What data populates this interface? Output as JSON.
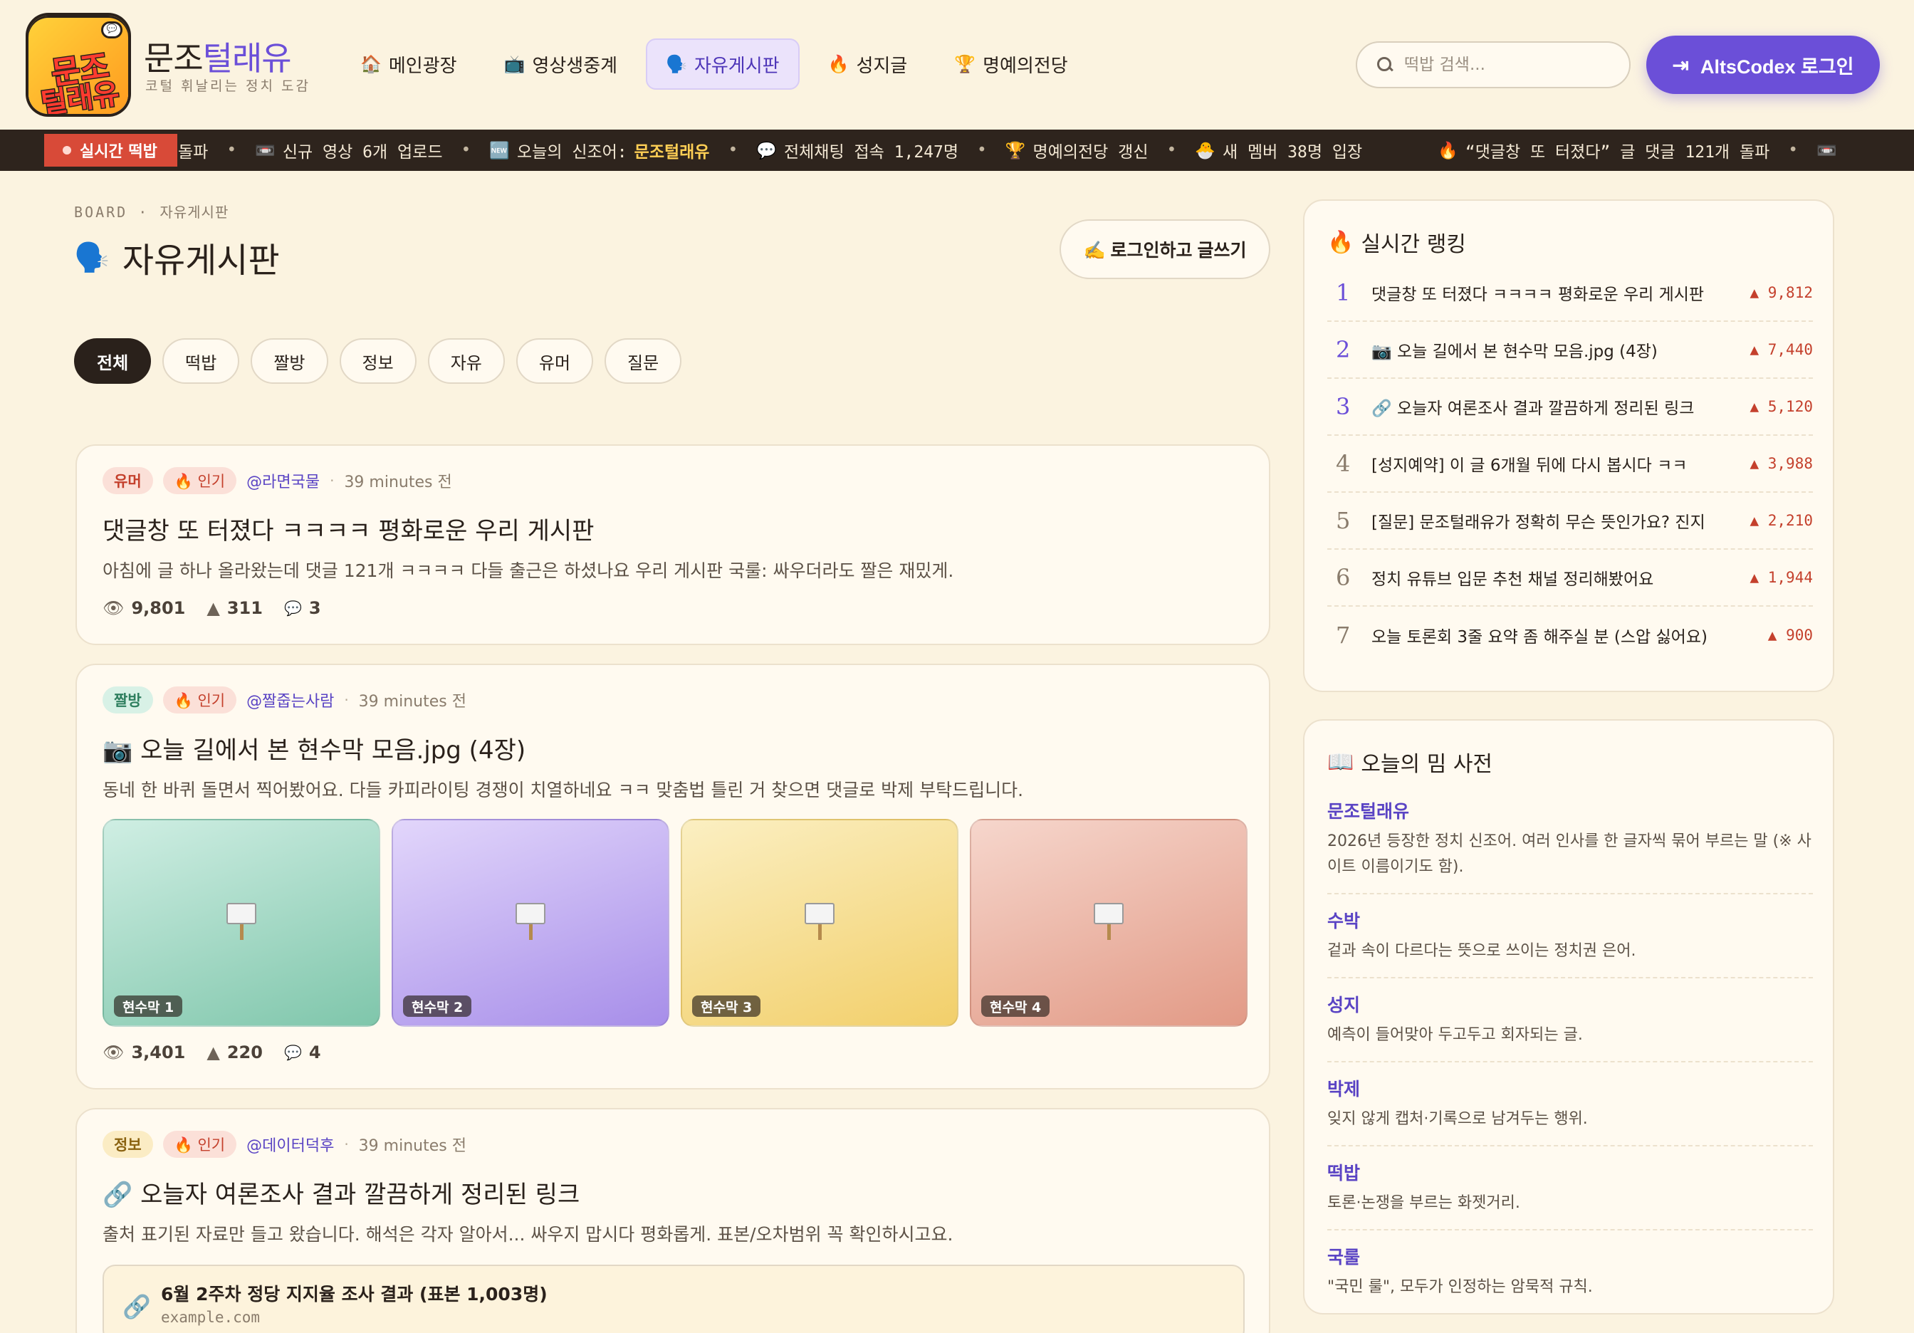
{
  "brand": {
    "logo_line1": "문조",
    "logo_line2": "털래유",
    "title_plain": "문조",
    "title_accent": "털래유",
    "subtitle": "코털 휘날리는 정치 도감"
  },
  "nav": [
    {
      "icon": "🏠",
      "label": "메인광장"
    },
    {
      "icon": "📺",
      "label": "영상생중계"
    },
    {
      "icon": "🗣️",
      "label": "자유게시판"
    },
    {
      "icon": "🔥",
      "label": "성지글"
    },
    {
      "icon": "🏆",
      "label": "명예의전당"
    }
  ],
  "search": {
    "placeholder": "떡밥 검색..."
  },
  "login_button": {
    "label": "AltsCodex 로그인"
  },
  "ticker": {
    "label": "실시간 떡밥",
    "lead_text": "돌파",
    "items": [
      {
        "icon": "📼",
        "text": "신규 영상 6개 업로드"
      },
      {
        "icon": "🆕",
        "text": "오늘의 신조어:",
        "highlight": "문조털래유"
      },
      {
        "icon": "💬",
        "text": "전체채팅 접속 1,247명"
      },
      {
        "icon": "🏆",
        "text": "명예의전당 갱신"
      },
      {
        "icon": "🐣",
        "text": "새 멤버 38명 입장"
      },
      {
        "icon": "🔥",
        "text": "“댓글창 또 터졌다” 글 댓글 121개 돌파"
      }
    ],
    "tail_icon": "📼"
  },
  "board": {
    "breadcrumb_en": "BOARD",
    "breadcrumb_sep": "·",
    "breadcrumb_kr": "자유게시판",
    "title_icon": "🗣️",
    "title": "자유게시판",
    "write_button": "✍️ 로그인하고 글쓰기",
    "chips": [
      "전체",
      "떡밥",
      "짤방",
      "정보",
      "자유",
      "유머",
      "질문"
    ]
  },
  "posts": [
    {
      "category": "유머",
      "hot_label": "🔥 인기",
      "author": "@라면국물",
      "time": "39 minutes 전",
      "title": "댓글창 또 터졌다 ㅋㅋㅋㅋ 평화로운 우리 게시판",
      "excerpt": "아침에 글 하나 올라왔는데 댓글 121개 ㅋㅋㅋㅋ 다들 출근은 하셨나요 우리 게시판 국룰: 싸우더라도 짤은 재밌게.",
      "views": "9,801",
      "votes": "311",
      "comments": "3"
    },
    {
      "category": "짤방",
      "hot_label": "🔥 인기",
      "author": "@짤줍는사람",
      "time": "39 minutes 전",
      "title": "📷 오늘 길에서 본 현수막 모음.jpg (4장)",
      "excerpt": "동네 한 바퀴 돌면서 찍어봤어요. 다들 카피라이팅 경쟁이 치열하네요 ㅋㅋ 맞춤법 틀린 거 찾으면 댓글로 박제 부탁드립니다.",
      "images": [
        "현수막 1",
        "현수막 2",
        "현수막 3",
        "현수막 4"
      ],
      "views": "3,401",
      "votes": "220",
      "comments": "4"
    },
    {
      "category": "정보",
      "hot_label": "🔥 인기",
      "author": "@데이터덕후",
      "time": "39 minutes 전",
      "title": "🔗 오늘자 여론조사 결과 깔끔하게 정리된 링크",
      "excerpt": "출처 표기된 자료만 들고 왔습니다. 해석은 각자 알아서... 싸우지 맙시다 평화롭게. 표본/오차범위 꼭 확인하시고요.",
      "link": {
        "title": "6월 2주차 정당 지지율 조사 결과 (표본 1,003명)",
        "domain": "example.com"
      }
    }
  ],
  "ranking": {
    "icon": "🔥",
    "title": "실시간 랭킹",
    "items": [
      {
        "rank": "1",
        "title": "댓글창 또 터졌다 ㅋㅋㅋㅋ 평화로운 우리 게시판",
        "score": "▲ 9,812"
      },
      {
        "rank": "2",
        "title": "📷 오늘 길에서 본 현수막 모음.jpg (4장)",
        "score": "▲ 7,440"
      },
      {
        "rank": "3",
        "title": "🔗 오늘자 여론조사 결과 깔끔하게 정리된 링크",
        "score": "▲ 5,120"
      },
      {
        "rank": "4",
        "title": "[성지예약] 이 글 6개월 뒤에 다시 봅시다 ㅋㅋ",
        "score": "▲ 3,988"
      },
      {
        "rank": "5",
        "title": "[질문] 문조털래유가 정확히 무슨 뜻인가요? 진지",
        "score": "▲ 2,210"
      },
      {
        "rank": "6",
        "title": "정치 유튜브 입문 추천 채널 정리해봤어요",
        "score": "▲ 1,944"
      },
      {
        "rank": "7",
        "title": "오늘 토론회 3줄 요약 좀 해주실 분 (스압 싫어요)",
        "score": "▲ 900"
      }
    ]
  },
  "dictionary": {
    "icon": "📖",
    "title": "오늘의 밈 사전",
    "items": [
      {
        "term": "문조털래유",
        "def": "2026년 등장한 정치 신조어. 여러 인사를 한 글자씩 묶어 부르는 말 (※ 사이트 이름이기도 함)."
      },
      {
        "term": "수박",
        "def": "겉과 속이 다르다는 뜻으로 쓰이는 정치권 은어."
      },
      {
        "term": "성지",
        "def": "예측이 들어맞아 두고두고 회자되는 글."
      },
      {
        "term": "박제",
        "def": "잊지 않게 캡처·기록으로 남겨두는 행위."
      },
      {
        "term": "떡밥",
        "def": "토론·논쟁을 부르는 화젯거리."
      },
      {
        "term": "국룰",
        "def": "\"국민 룰\", 모두가 인정하는 암묵적 규칙."
      }
    ]
  }
}
